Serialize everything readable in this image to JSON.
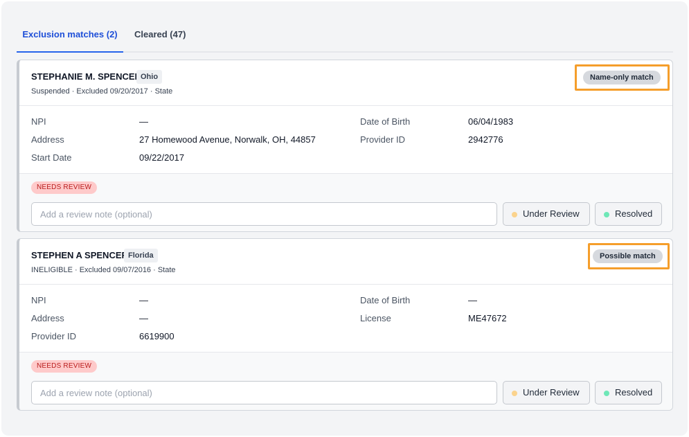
{
  "tabs": [
    {
      "label": "Exclusion matches (2)",
      "active": true
    },
    {
      "label": "Cleared (47)",
      "active": false
    }
  ],
  "colors": {
    "accent": "#2563eb",
    "highlight": "#f59e2b",
    "needs_review": "#fecaca",
    "under_review_dot": "#fbd38d",
    "resolved_dot": "#6ee7b7"
  },
  "cards": [
    {
      "name": "STEPHANIE M. SPENCER",
      "state": "Ohio",
      "subtitle": "Suspended · Excluded 09/20/2017 · State",
      "match": "Name-only match",
      "fields": {
        "left": [
          {
            "label": "NPI",
            "value": "—"
          },
          {
            "label": "Address",
            "value": "27 Homewood Avenue, Norwalk, OH, 44857"
          },
          {
            "label": "Start Date",
            "value": "09/22/2017"
          }
        ],
        "right": [
          {
            "label": "Date of Birth",
            "value": "06/04/1983"
          },
          {
            "label": "Provider ID",
            "value": "2942776"
          }
        ]
      },
      "status": "NEEDS REVIEW",
      "note_placeholder": "Add a review note (optional)",
      "under_review_label": "Under Review",
      "resolved_label": "Resolved"
    },
    {
      "name": "STEPHEN A SPENCER",
      "state": "Florida",
      "subtitle": "INELIGIBLE · Excluded 09/07/2016 · State",
      "match": "Possible match",
      "fields": {
        "left": [
          {
            "label": "NPI",
            "value": "—"
          },
          {
            "label": "Address",
            "value": "—"
          },
          {
            "label": "Provider ID",
            "value": "6619900"
          }
        ],
        "right": [
          {
            "label": "Date of Birth",
            "value": "—"
          },
          {
            "label": "License",
            "value": "ME47672"
          }
        ]
      },
      "status": "NEEDS REVIEW",
      "note_placeholder": "Add a review note (optional)",
      "under_review_label": "Under Review",
      "resolved_label": "Resolved"
    }
  ]
}
